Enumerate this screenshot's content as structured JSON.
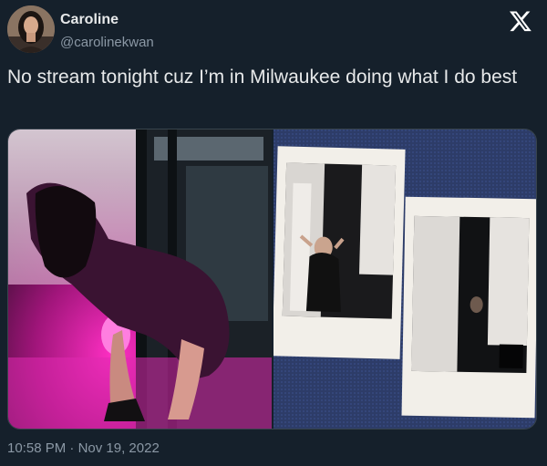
{
  "author": {
    "display_name": "Caroline",
    "handle": "@carolinekwan",
    "avatar_icon": "profile-photo"
  },
  "brand": {
    "icon": "x-logo-icon",
    "color": "#ffffff"
  },
  "tweet": {
    "text": "No stream tonight cuz I’m in Milwaukee doing what I do best"
  },
  "media": {
    "photos": [
      {
        "description_icon": "photo-pink-lights"
      },
      {
        "description_icon": "photo-polaroids"
      }
    ]
  },
  "meta": {
    "time": "10:58 PM",
    "separator": "·",
    "date": "Nov 19, 2022"
  },
  "colors": {
    "background": "#15202b",
    "primary_text": "#e7e9ea",
    "secondary_text": "#8b98a5",
    "accent_pink": "#ff1fb4"
  }
}
